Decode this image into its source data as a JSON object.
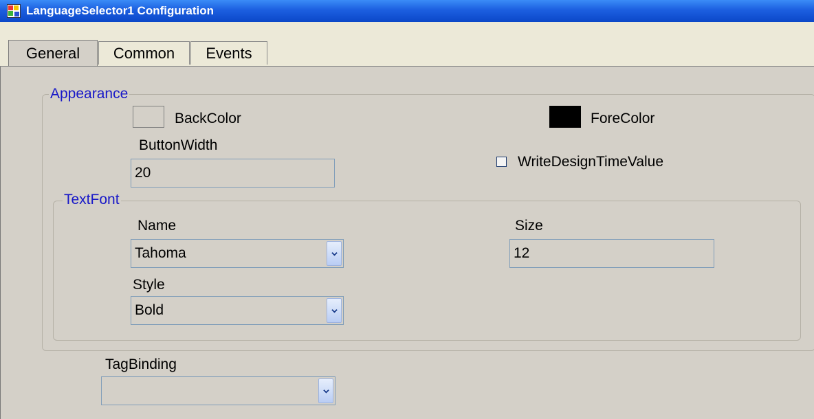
{
  "window": {
    "title": "LanguageSelector1 Configuration"
  },
  "tabs": [
    {
      "label": "General",
      "active": true
    },
    {
      "label": "Common",
      "active": false
    },
    {
      "label": "Events",
      "active": false
    }
  ],
  "appearance": {
    "legend": "Appearance",
    "back_color": {
      "label": "BackColor",
      "value": "#D4D0C8"
    },
    "fore_color": {
      "label": "ForeColor",
      "value": "#000000"
    },
    "button_width": {
      "label": "ButtonWidth",
      "value": "20"
    },
    "write_design_time_value": {
      "label": "WriteDesignTimeValue",
      "checked": false
    }
  },
  "text_font": {
    "legend": "TextFont",
    "name": {
      "label": "Name",
      "value": "Tahoma"
    },
    "size": {
      "label": "Size",
      "value": "12"
    },
    "style": {
      "label": "Style",
      "value": "Bold"
    }
  },
  "tag_binding": {
    "label": "TagBinding",
    "value": ""
  },
  "colors": {
    "legend_text": "#1818C8",
    "panel": "#D4D0C8",
    "titlebar": "#1C5FE0"
  },
  "icons": {
    "app": "app-window-icon",
    "dropdown": "chevron-down-icon"
  }
}
